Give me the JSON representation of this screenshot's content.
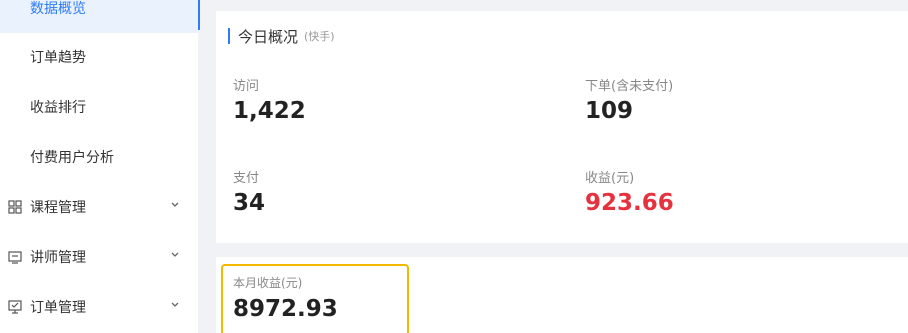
{
  "sidebar": {
    "items": [
      {
        "label": "数据概览"
      },
      {
        "label": "订单趋势"
      },
      {
        "label": "收益排行"
      },
      {
        "label": "付费用户分析"
      }
    ],
    "groups": [
      {
        "label": "课程管理",
        "icon": "grid-icon"
      },
      {
        "label": "讲师管理",
        "icon": "teacher-icon"
      },
      {
        "label": "订单管理",
        "icon": "order-icon"
      }
    ]
  },
  "today": {
    "title": "今日概况",
    "subtitle": "(快手)",
    "stats": {
      "visits": {
        "label": "访问",
        "value": "1,422"
      },
      "orders": {
        "label": "下单(含未支付)",
        "value": "109"
      },
      "paid": {
        "label": "支付",
        "value": "34"
      },
      "revenue": {
        "label": "收益(元)",
        "value": "923.66"
      }
    }
  },
  "month": {
    "label": "本月收益(元)",
    "value": "8972.93"
  },
  "colors": {
    "accent": "#2f7cf6",
    "revenue_red": "#e5323e",
    "highlight_border": "#f5b800"
  }
}
